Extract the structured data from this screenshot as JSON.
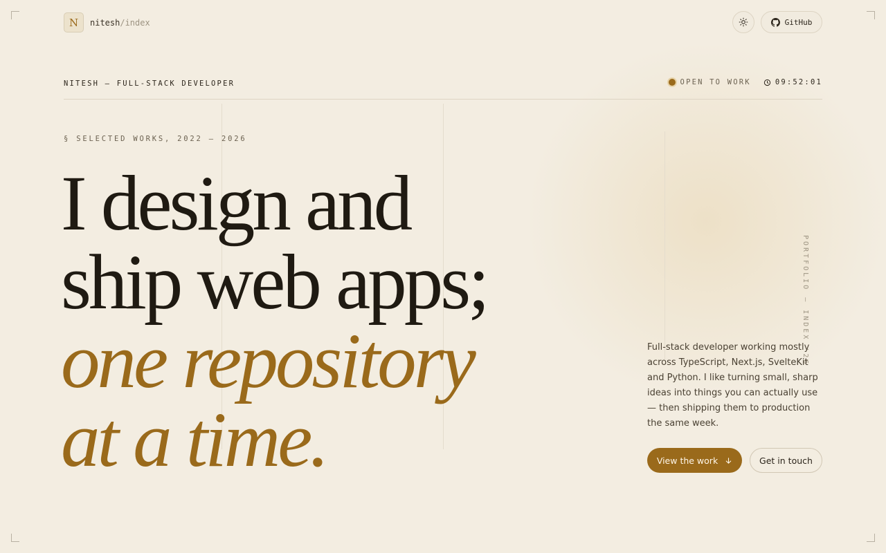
{
  "brand": {
    "logo_letter": "N",
    "name": "nitesh",
    "path": "/index"
  },
  "nav": {
    "theme_icon": "sun-icon",
    "github_label": "GitHub",
    "github_icon": "github-icon"
  },
  "meta": {
    "title": "NITESH — FULL-STACK DEVELOPER",
    "status": "OPEN TO WORK",
    "time": "09:52:01",
    "clock_icon": "clock-icon"
  },
  "eyebrow": "§ SELECTED WORKS, 2022 — 2026",
  "hero": {
    "line1": "I design and",
    "line2": "ship web apps;",
    "line3": "one repository",
    "line4": "at a time."
  },
  "side_label": "PORTFOLIO — INDEX '26",
  "intro": "Full-stack developer working mostly across TypeScript, Next.js, SvelteKit and Python. I like turning small, sharp ideas into things you can actually use — then shipping them to production the same week.",
  "actions": {
    "primary": "View the work",
    "primary_icon": "arrow-down-icon",
    "secondary": "Get in touch"
  },
  "colors": {
    "accent": "#9a6a1b",
    "background": "#f3ede1",
    "ink": "#1f1a12"
  }
}
